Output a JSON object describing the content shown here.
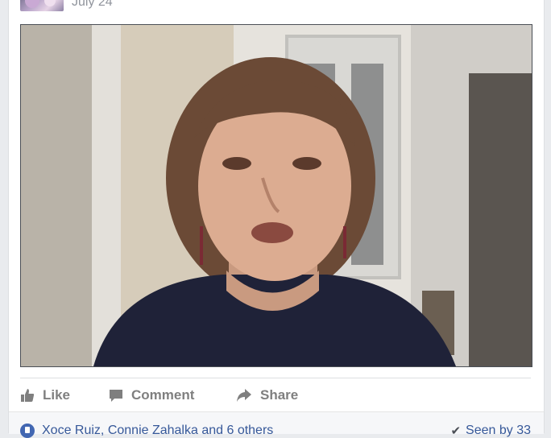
{
  "post": {
    "date": "July 24"
  },
  "actions": {
    "like_label": "Like",
    "comment_label": "Comment",
    "share_label": "Share"
  },
  "footer": {
    "likers_text": "Xoce Ruiz, Connie Zahalka and 6 others",
    "seen_text": "Seen by 33"
  },
  "icons": {
    "like": "thumbs-up-icon",
    "comment": "speech-bubble-icon",
    "share": "share-arrow-icon",
    "reaction": "like-reaction-icon",
    "seen": "checkmark-icon"
  },
  "colors": {
    "link": "#365899",
    "action_text": "#7f7f7f",
    "background": "#e9ebee"
  }
}
